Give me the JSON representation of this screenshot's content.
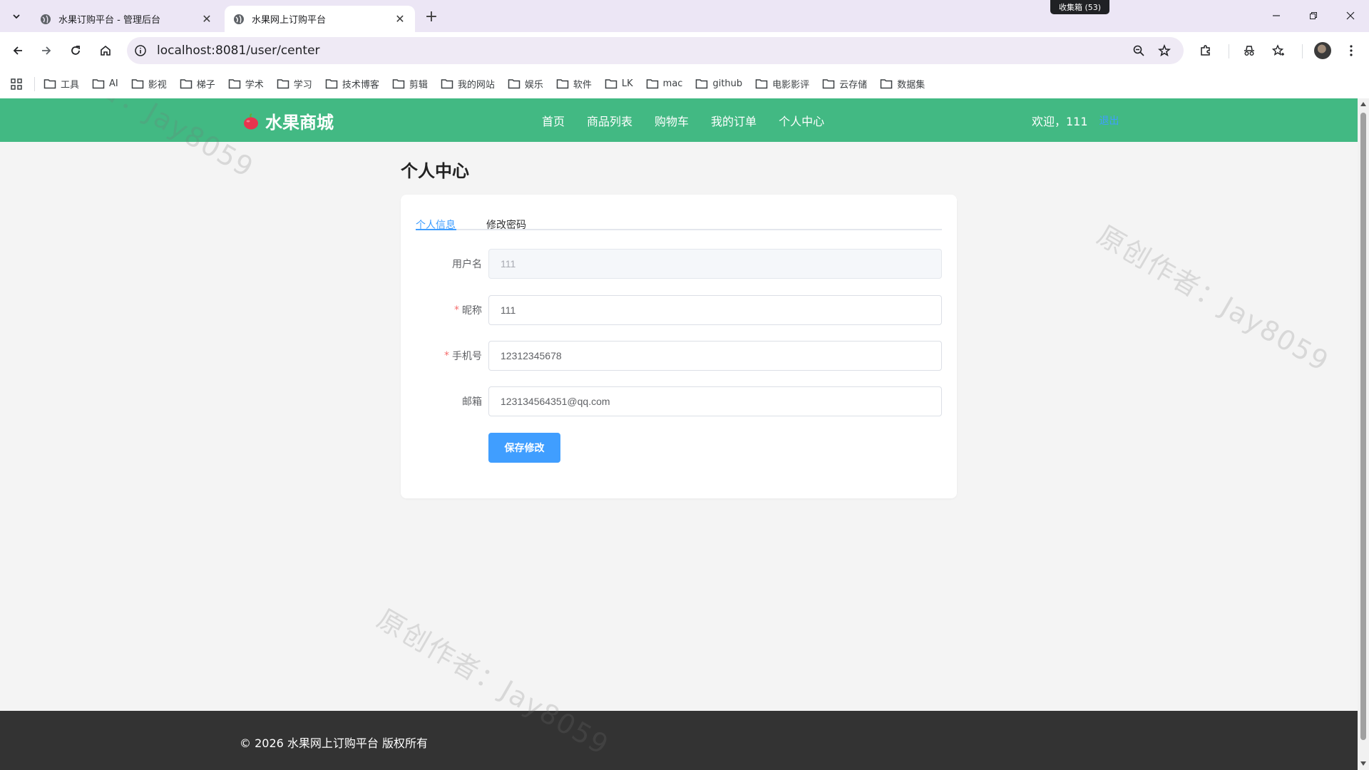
{
  "browser": {
    "tabs": [
      {
        "title": "水果订购平台 - 管理后台",
        "active": false
      },
      {
        "title": "水果网上订购平台",
        "active": true
      }
    ],
    "collect_badge": "收集箱 (53)",
    "url": "localhost:8081/user/center",
    "bookmarks": [
      "工具",
      "AI",
      "影视",
      "梯子",
      "学术",
      "学习",
      "技术博客",
      "剪辑",
      "我的网站",
      "娱乐",
      "软件",
      "LK",
      "mac",
      "github",
      "电影影评",
      "云存储",
      "数据集"
    ]
  },
  "site": {
    "logo_text": "水果商城",
    "nav": [
      "首页",
      "商品列表",
      "购物车",
      "我的订单",
      "个人中心"
    ],
    "welcome": "欢迎，111",
    "logout": "退出",
    "brand_color": "#42b983"
  },
  "page": {
    "title": "个人中心",
    "tabs": [
      {
        "label": "个人信息",
        "active": true
      },
      {
        "label": "修改密码",
        "active": false
      }
    ],
    "form": {
      "username": {
        "label": "用户名",
        "value": "111",
        "disabled": true,
        "required": false
      },
      "nickname": {
        "label": "昵称",
        "value": "111",
        "required": true
      },
      "phone": {
        "label": "手机号",
        "value": "12312345678",
        "required": true
      },
      "email": {
        "label": "邮箱",
        "value": "123134564351@qq.com",
        "required": false
      },
      "required_mark": "*"
    },
    "save_label": "保存修改",
    "accent_color": "#409eff"
  },
  "footer": {
    "text": "© 2026 水果网上订购平台 版权所有"
  },
  "watermark": "原创作者：Jay8059"
}
